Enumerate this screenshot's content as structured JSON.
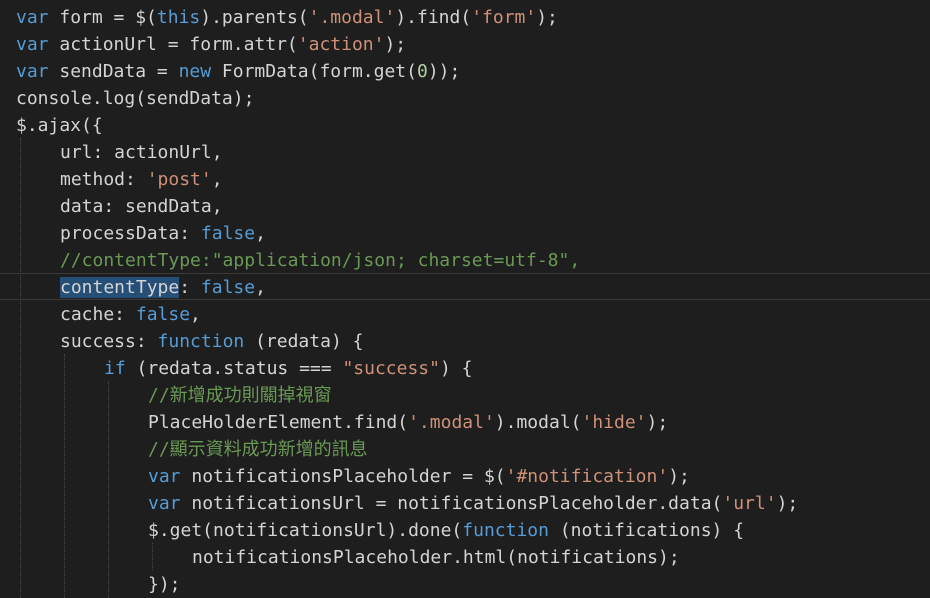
{
  "code": {
    "l1": {
      "a": "var",
      "b": " form = $(",
      "c": "this",
      "d": ").parents(",
      "e": "'.modal'",
      "f": ").find(",
      "g": "'form'",
      "h": ");"
    },
    "l2": {
      "a": "var",
      "b": " actionUrl = form.attr(",
      "c": "'action'",
      "d": ");"
    },
    "l3": {
      "a": "var",
      "b": " sendData = ",
      "c": "new",
      "d": " FormData(form.get(",
      "e": "0",
      "f": "));"
    },
    "l4": {
      "a": "console.log(sendData);"
    },
    "l5": {
      "a": "$.ajax({"
    },
    "l6": {
      "a": "url: actionUrl,"
    },
    "l7": {
      "a": "method: ",
      "b": "'post'",
      "c": ","
    },
    "l8": {
      "a": "data: sendData,"
    },
    "l9": {
      "a": "processData: ",
      "b": "false",
      "c": ","
    },
    "l10": {
      "a": "//contentType:\"application/json; charset=utf-8\","
    },
    "l11": {
      "a": "contentType",
      "b": ": ",
      "c": "false",
      "d": ","
    },
    "l12": {
      "a": "cache: ",
      "b": "false",
      "c": ","
    },
    "l13": {
      "a": "success: ",
      "b": "function",
      "c": " (redata) {"
    },
    "l14": {
      "a": "if",
      "b": " (redata.status === ",
      "c": "\"success\"",
      "d": ") {"
    },
    "l15": {
      "a": "//新增成功則關掉視窗"
    },
    "l16": {
      "a": "PlaceHolderElement.find(",
      "b": "'.modal'",
      "c": ").modal(",
      "d": "'hide'",
      "e": ");"
    },
    "l17": {
      "a": "//顯示資料成功新增的訊息"
    },
    "l18": {
      "a": "var",
      "b": " notificationsPlaceholder = $(",
      "c": "'#notification'",
      "d": ");"
    },
    "l19": {
      "a": "var",
      "b": " notificationsUrl = notificationsPlaceholder.data(",
      "c": "'url'",
      "d": ");"
    },
    "l20": {
      "a": "$.get(notificationsUrl).done(",
      "b": "function",
      "c": " (notifications) {"
    },
    "l21": {
      "a": "notificationsPlaceholder.html(notifications);"
    },
    "l22": {
      "a": "});"
    }
  },
  "colors": {
    "background": "#1e1e1e",
    "text": "#d4d4d4",
    "keyword": "#569cd6",
    "string": "#ce9178",
    "comment": "#6a9955",
    "number": "#b5cea8",
    "selection": "#264f78"
  }
}
